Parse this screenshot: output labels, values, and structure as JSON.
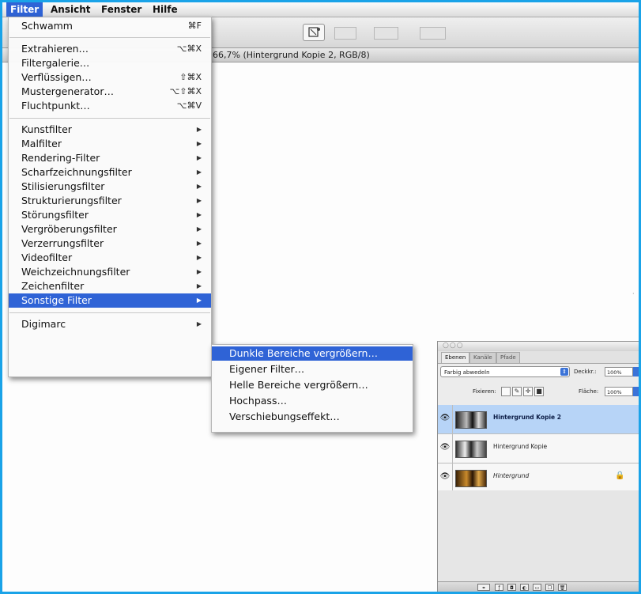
{
  "menubar": {
    "items": [
      {
        "label": "Filter"
      },
      {
        "label": "Ansicht"
      },
      {
        "label": "Fenster"
      },
      {
        "label": "Hilfe"
      }
    ]
  },
  "document": {
    "title": "66,7% (Hintergrund Kopie 2, RGB/8)"
  },
  "filter_menu": {
    "items": [
      {
        "label": "Schwamm",
        "shortcut": "⌘F"
      },
      {
        "label": "Extrahieren…",
        "shortcut": "⌥⌘X"
      },
      {
        "label": "Filtergalerie…",
        "shortcut": ""
      },
      {
        "label": "Verflüssigen…",
        "shortcut": "⇧⌘X"
      },
      {
        "label": "Mustergenerator…",
        "shortcut": "⌥⇧⌘X"
      },
      {
        "label": "Fluchtpunkt…",
        "shortcut": "⌥⌘V"
      },
      {
        "label": "Kunstfilter"
      },
      {
        "label": "Malfilter"
      },
      {
        "label": "Rendering-Filter"
      },
      {
        "label": "Scharfzeichnungsfilter"
      },
      {
        "label": "Stilisierungsfilter"
      },
      {
        "label": "Strukturierungsfilter"
      },
      {
        "label": "Störungsfilter"
      },
      {
        "label": "Vergröberungsfilter"
      },
      {
        "label": "Verzerrungsfilter"
      },
      {
        "label": "Videofilter"
      },
      {
        "label": "Weichzeichnungsfilter"
      },
      {
        "label": "Zeichenfilter"
      },
      {
        "label": "Sonstige Filter"
      },
      {
        "label": "Digimarc"
      }
    ],
    "submenu_arrow": "▶"
  },
  "submenu": {
    "items": [
      {
        "label": "Dunkle Bereiche vergrößern…"
      },
      {
        "label": "Eigener Filter…"
      },
      {
        "label": "Helle Bereiche vergrößern…"
      },
      {
        "label": "Hochpass…"
      },
      {
        "label": "Verschiebungseffekt…"
      }
    ]
  },
  "layers_panel": {
    "tabs": [
      {
        "label": "Ebenen"
      },
      {
        "label": "Kanäle"
      },
      {
        "label": "Pfade"
      }
    ],
    "blend_mode": "Farbig abwedeln",
    "opacity_label": "Deckkr.:",
    "opacity_value": "100%",
    "fill_label": "Fläche:",
    "fill_value": "100%",
    "lock_label": "Fixieren:",
    "layers": [
      {
        "name": "Hintergrund Kopie 2",
        "selected": true,
        "locked": false
      },
      {
        "name": "Hintergrund Kopie",
        "selected": false,
        "locked": false
      },
      {
        "name": "Hintergrund",
        "selected": false,
        "locked": true
      }
    ]
  },
  "colors": {
    "highlight": "#2f63d6",
    "frame_border": "#1aa3e8",
    "layer_selected": "#b7d4f7"
  },
  "icons": {
    "eye": "eye-icon",
    "lock": "lock-icon",
    "tool": "fill-tool-icon"
  }
}
